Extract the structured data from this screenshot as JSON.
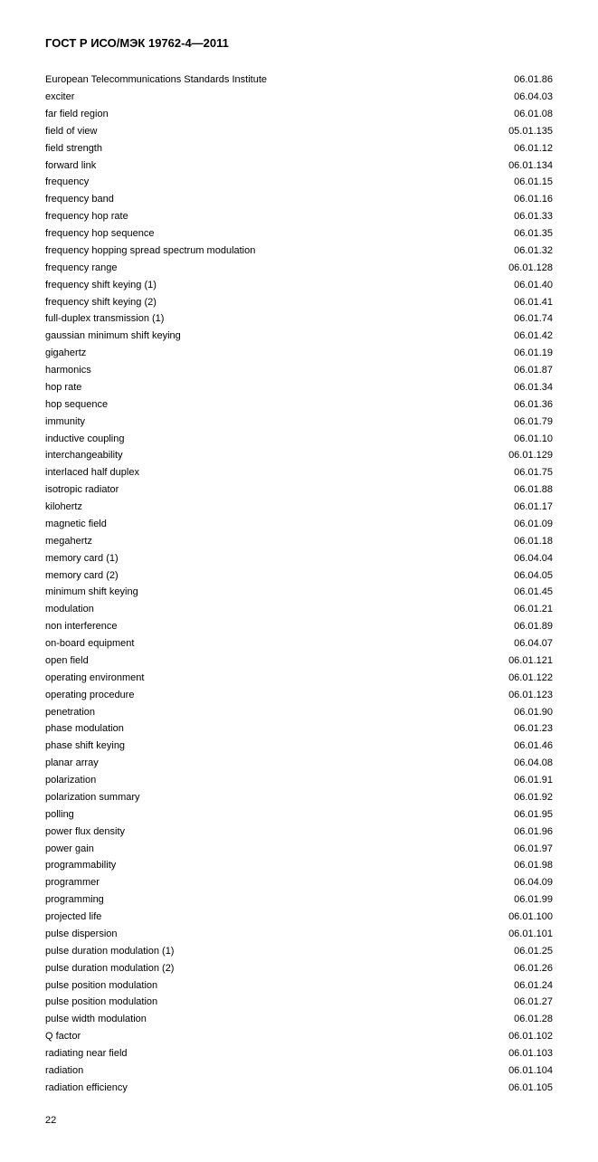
{
  "title": "ГОСТ Р ИСО/МЭК 19762-4—2011",
  "entries": [
    {
      "term": "European Telecommunications Standards Institute",
      "ref": "06.01.86"
    },
    {
      "term": "exciter",
      "ref": "06.04.03"
    },
    {
      "term": "far field region",
      "ref": "06.01.08"
    },
    {
      "term": "field of view",
      "ref": "05.01.135"
    },
    {
      "term": "field strength",
      "ref": "06.01.12"
    },
    {
      "term": "forward link",
      "ref": "06.01.134"
    },
    {
      "term": "frequency",
      "ref": "06.01.15"
    },
    {
      "term": "frequency band",
      "ref": "06.01.16"
    },
    {
      "term": "frequency hop rate",
      "ref": "06.01.33"
    },
    {
      "term": "frequency hop sequence",
      "ref": "06.01.35"
    },
    {
      "term": "frequency hopping spread spectrum modulation",
      "ref": "06.01.32"
    },
    {
      "term": "frequency range",
      "ref": "06.01.128"
    },
    {
      "term": "frequency shift keying (1)",
      "ref": "06.01.40"
    },
    {
      "term": "frequency shift keying (2)",
      "ref": "06.01.41"
    },
    {
      "term": "full-duplex transmission (1)",
      "ref": "06.01.74"
    },
    {
      "term": "gaussian minimum shift keying",
      "ref": "06.01.42"
    },
    {
      "term": "gigahertz",
      "ref": "06.01.19"
    },
    {
      "term": "harmonics",
      "ref": "06.01.87"
    },
    {
      "term": "hop rate",
      "ref": "06.01.34"
    },
    {
      "term": "hop sequence",
      "ref": "06.01.36"
    },
    {
      "term": "immunity",
      "ref": "06.01.79"
    },
    {
      "term": "inductive coupling",
      "ref": "06.01.10"
    },
    {
      "term": "interchangeability",
      "ref": "06.01.129"
    },
    {
      "term": "interlaced half duplex",
      "ref": "06.01.75"
    },
    {
      "term": "isotropic radiator",
      "ref": "06.01.88"
    },
    {
      "term": "kilohertz",
      "ref": "06.01.17"
    },
    {
      "term": "magnetic field",
      "ref": "06.01.09"
    },
    {
      "term": "megahertz",
      "ref": "06.01.18"
    },
    {
      "term": "memory card (1)",
      "ref": "06.04.04"
    },
    {
      "term": "memory card (2)",
      "ref": "06.04.05"
    },
    {
      "term": "minimum shift keying",
      "ref": "06.01.45"
    },
    {
      "term": "modulation",
      "ref": "06.01.21"
    },
    {
      "term": "non interference",
      "ref": "06.01.89"
    },
    {
      "term": "on-board equipment",
      "ref": "06.04.07"
    },
    {
      "term": "open field",
      "ref": "06.01.121"
    },
    {
      "term": "operating environment",
      "ref": "06.01.122"
    },
    {
      "term": "operating procedure",
      "ref": "06.01.123"
    },
    {
      "term": "penetration",
      "ref": "06.01.90"
    },
    {
      "term": "phase modulation",
      "ref": "06.01.23"
    },
    {
      "term": "phase shift keying",
      "ref": "06.01.46"
    },
    {
      "term": "planar array",
      "ref": "06.04.08"
    },
    {
      "term": "polarization",
      "ref": "06.01.91"
    },
    {
      "term": "polarization summary",
      "ref": "06.01.92"
    },
    {
      "term": "polling",
      "ref": "06.01.95"
    },
    {
      "term": "power flux density",
      "ref": "06.01.96"
    },
    {
      "term": "power gain",
      "ref": "06.01.97"
    },
    {
      "term": "programmability",
      "ref": "06.01.98"
    },
    {
      "term": "programmer",
      "ref": "06.04.09"
    },
    {
      "term": "programming",
      "ref": "06.01.99"
    },
    {
      "term": "projected life",
      "ref": "06.01.100"
    },
    {
      "term": "pulse dispersion",
      "ref": "06.01.101"
    },
    {
      "term": "pulse duration modulation (1)",
      "ref": "06.01.25"
    },
    {
      "term": "pulse duration modulation (2)",
      "ref": "06.01.26"
    },
    {
      "term": "pulse position modulation",
      "ref": "06.01.24"
    },
    {
      "term": "pulse position modulation",
      "ref": "06.01.27"
    },
    {
      "term": "pulse width modulation",
      "ref": "06.01.28"
    },
    {
      "term": "Q factor",
      "ref": "06.01.102"
    },
    {
      "term": "radiating near field",
      "ref": "06.01.103"
    },
    {
      "term": "radiation",
      "ref": "06.01.104"
    },
    {
      "term": "radiation efficiency",
      "ref": "06.01.105"
    }
  ],
  "page_number": "22"
}
